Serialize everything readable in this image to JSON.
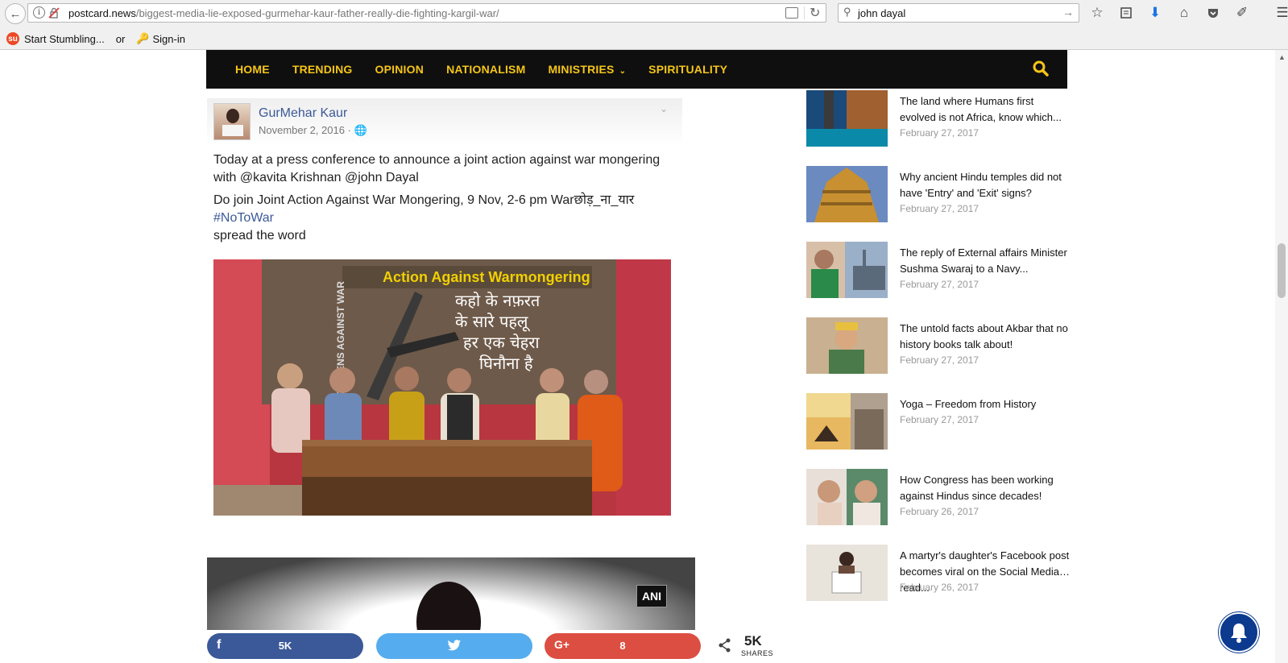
{
  "browser": {
    "url_domain": "postcard.news",
    "url_path": "/biggest-media-lie-exposed-gurmehar-kaur-father-really-die-fighting-kargil-war/",
    "search_value": "john dayal",
    "bookmarks": {
      "stumble": "Start Stumbling...",
      "or": "or",
      "signin": "Sign-in"
    }
  },
  "site_nav": {
    "items": [
      "HOME",
      "TRENDING",
      "OPINION",
      "NATIONALISM",
      "MINISTRIES",
      "SPIRITUALITY"
    ],
    "accent_color": "#f5c518"
  },
  "fb_post": {
    "author": "GurMehar Kaur",
    "date": "November 2, 2016 · ",
    "line1": "Today at a press conference to announce a joint action against war mongering with @kavita Krishnan @john Dayal",
    "line2": "Do join Joint Action Against War Mongering, 9 Nov, 2-6 pm Warछोड़_ना_यार",
    "hashtag": "#NoToWar",
    "line3": "spread the word",
    "banner_text": "Action Against Warmongering",
    "banner_hindi": [
      "कहो के नफ़रत",
      "के सारे पहलू",
      "हर एक चेहरा",
      "घिनौना है"
    ],
    "banner_side": "CITIZENS AGAINST WAR"
  },
  "video": {
    "badge": "ANI"
  },
  "share": {
    "facebook_count": "5K",
    "google_count": "8",
    "total": "5K",
    "total_label": "SHARES"
  },
  "sidebar": {
    "items": [
      {
        "title": "The land where Humans first evolved is not Africa, know which...",
        "date": "February 27, 2017"
      },
      {
        "title": "Why ancient Hindu temples did not have 'Entry' and 'Exit' signs?",
        "date": "February 27, 2017"
      },
      {
        "title": "The reply of External affairs Minister Sushma Swaraj to a Navy...",
        "date": "February 27, 2017"
      },
      {
        "title": "The untold facts about Akbar that no history books talk about!",
        "date": "February 27, 2017"
      },
      {
        "title": "Yoga – Freedom from History",
        "date": "February 27, 2017"
      },
      {
        "title": "How Congress has been working against Hindus since decades!",
        "date": "February 26, 2017"
      },
      {
        "title": "A martyr's daughter's Facebook post becomes viral on the Social Media…read...",
        "date": "February 26, 2017"
      }
    ]
  }
}
